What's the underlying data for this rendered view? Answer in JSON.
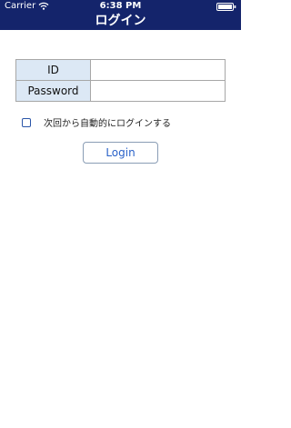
{
  "status_bar": {
    "carrier": "Carrier",
    "time": "6:38 PM"
  },
  "nav": {
    "title": "ログイン"
  },
  "form": {
    "id_label": "ID",
    "id_value": "",
    "password_label": "Password",
    "password_value": ""
  },
  "auto_login": {
    "label": "次回から自動的にログインする",
    "checked": false
  },
  "login_button": {
    "label": "Login"
  },
  "colors": {
    "header_bg": "#14246b",
    "label_cell_bg": "#dce8f5",
    "button_text": "#2a62c9"
  },
  "icons": [
    "wifi-icon",
    "battery-icon",
    "checkbox-icon"
  ]
}
